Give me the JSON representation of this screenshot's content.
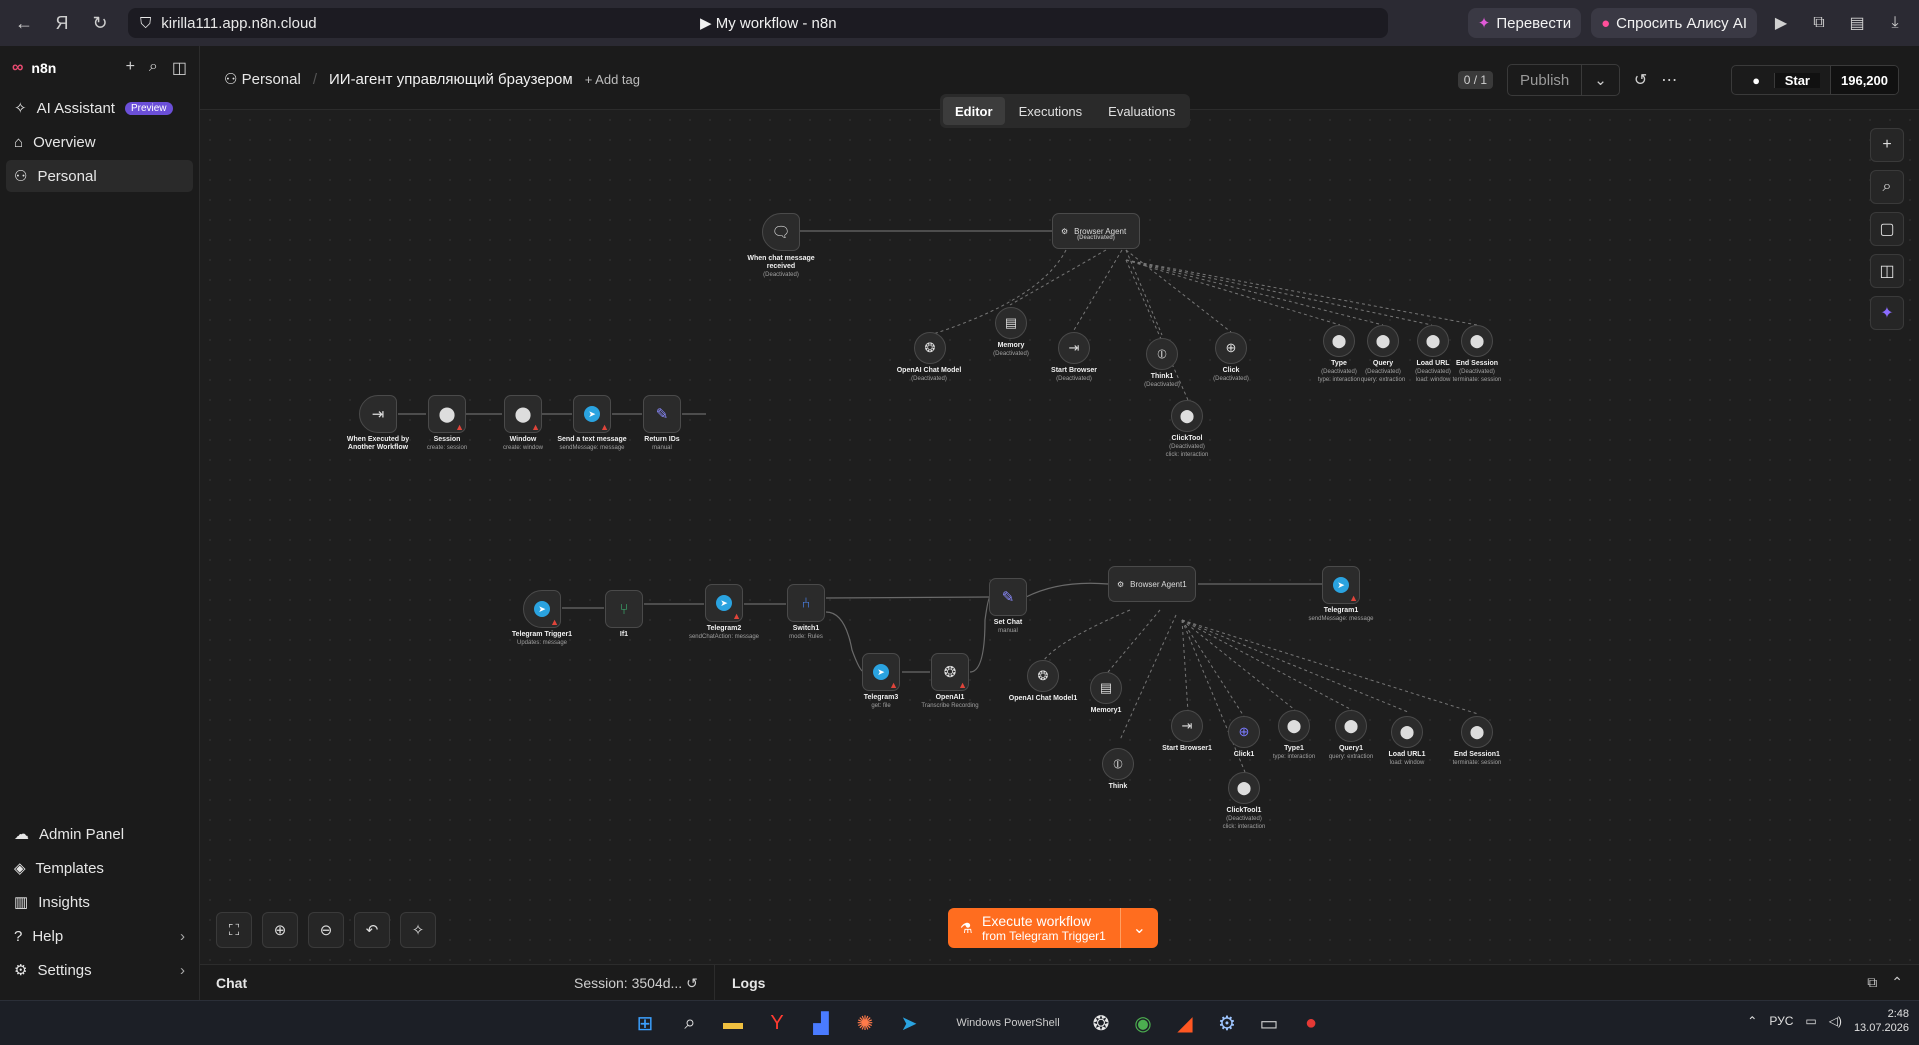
{
  "browser": {
    "url": "kirilla111.app.n8n.cloud",
    "page_title": "▶ My workflow - n8n",
    "translate_btn": "Перевести",
    "alice_btn": "Спросить Алису AI"
  },
  "sidebar": {
    "brand": "n8n",
    "items": [
      {
        "label": "AI Assistant",
        "badge": "Preview"
      },
      {
        "label": "Overview"
      },
      {
        "label": "Personal"
      }
    ],
    "bottom": [
      {
        "label": "Admin Panel"
      },
      {
        "label": "Templates"
      },
      {
        "label": "Insights"
      },
      {
        "label": "Help"
      },
      {
        "label": "Settings"
      }
    ]
  },
  "header": {
    "project": "Personal",
    "workflow_name": "ИИ-агент управляющий браузером",
    "add_tag": "+ Add tag",
    "version_counter": "0 / 1",
    "publish": "Publish",
    "star": "Star",
    "star_count": "196,200"
  },
  "tabs": [
    "Editor",
    "Executions",
    "Evaluations"
  ],
  "nodes": {
    "chat_trigger": {
      "title": "When chat message received",
      "status": "(Deactivated)"
    },
    "agent1": {
      "title": "Browser Agent",
      "status": "(Deactivated)"
    },
    "openai_model": {
      "title": "OpenAI Chat Model",
      "status": "(Deactivated)"
    },
    "memory": {
      "title": "Memory",
      "status": "(Deactivated)"
    },
    "start_browser": {
      "title": "Start Browser",
      "status": "(Deactivated)"
    },
    "think1": {
      "title": "Think1",
      "status": "(Deactivated)"
    },
    "click": {
      "title": "Click",
      "status": "(Deactivated)"
    },
    "type": {
      "title": "Type",
      "status": "(Deactivated)",
      "sub": "type: interaction"
    },
    "query": {
      "title": "Query",
      "status": "(Deactivated)",
      "sub": "query: extraction"
    },
    "load_url": {
      "title": "Load URL",
      "status": "(Deactivated)",
      "sub": "load: window"
    },
    "end_session": {
      "title": "End Session",
      "status": "(Deactivated)",
      "sub": "terminate: session"
    },
    "clicktool": {
      "title": "ClickTool",
      "status": "(Deactivated)",
      "sub": "click: interaction"
    },
    "exec_trigger": {
      "title": "When Executed by Another Workflow"
    },
    "session": {
      "title": "Session",
      "sub": "create: session"
    },
    "window": {
      "title": "Window",
      "sub": "create: window"
    },
    "send_text": {
      "title": "Send a text message",
      "sub": "sendMessage: message"
    },
    "return_ids": {
      "title": "Return IDs",
      "sub": "manual"
    },
    "tg_trigger": {
      "title": "Telegram Trigger1",
      "sub": "Updates: message"
    },
    "if1": {
      "title": "If1"
    },
    "telegram2": {
      "title": "Telegram2",
      "sub": "sendChatAction: message"
    },
    "switch1": {
      "title": "Switch1",
      "sub": "mode: Rules"
    },
    "telegram3": {
      "title": "Telegram3",
      "sub": "get: file"
    },
    "openai1": {
      "title": "OpenAI1",
      "sub": "Transcribe Recording"
    },
    "set_chat": {
      "title": "Set Chat",
      "sub": "manual"
    },
    "agent2": {
      "title": "Browser Agent1"
    },
    "telegram1": {
      "title": "Telegram1",
      "sub": "sendMessage: message"
    },
    "openai_model1": {
      "title": "OpenAI Chat Model1"
    },
    "memory1": {
      "title": "Memory1"
    },
    "start_browser1": {
      "title": "Start Browser1"
    },
    "click1": {
      "title": "Click1"
    },
    "type1": {
      "title": "Type1",
      "sub": "type: interaction"
    },
    "query1": {
      "title": "Query1",
      "sub": "query: extraction"
    },
    "load_url1": {
      "title": "Load URL1",
      "sub": "load: window"
    },
    "end_session1": {
      "title": "End Session1",
      "sub": "terminate: session"
    },
    "think": {
      "title": "Think"
    },
    "clicktool1": {
      "title": "ClickTool1",
      "status": "(Deactivated)",
      "sub": "click: interaction"
    }
  },
  "execute": {
    "label": "Execute workflow",
    "sub": "from Telegram Trigger1"
  },
  "logs": {
    "chat": "Chat",
    "session": "Session: 3504d...",
    "logs": "Logs"
  },
  "taskbar": {
    "lang": "РУС",
    "time": "2:48",
    "date": "13.07.2026",
    "powershell": "Windows PowerShell"
  }
}
